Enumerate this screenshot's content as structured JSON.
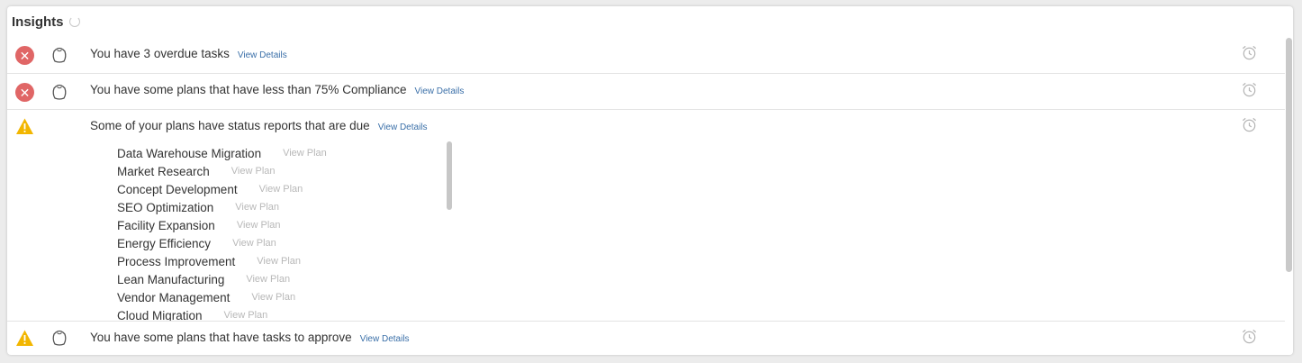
{
  "panel": {
    "title": "Insights",
    "loading_icon": "spinner-icon"
  },
  "insights": [
    {
      "status": "error",
      "status_icon": "error-circle-icon",
      "has_bag_icon": true,
      "message": "You have 3 overdue tasks",
      "link": "View Details"
    },
    {
      "status": "error",
      "status_icon": "error-circle-icon",
      "has_bag_icon": true,
      "message": "You have some plans that have less than 75% Compliance",
      "link": "View Details"
    },
    {
      "status": "warning",
      "status_icon": "warning-triangle-icon",
      "has_bag_icon": false,
      "message": "Some of your plans have status reports that are due",
      "link": "View Details",
      "plans": [
        {
          "name": "Data Warehouse Migration",
          "link": "View Plan"
        },
        {
          "name": "Market Research",
          "link": "View Plan"
        },
        {
          "name": "Concept Development",
          "link": "View Plan"
        },
        {
          "name": "SEO Optimization",
          "link": "View Plan"
        },
        {
          "name": "Facility Expansion",
          "link": "View Plan"
        },
        {
          "name": "Energy Efficiency",
          "link": "View Plan"
        },
        {
          "name": "Process Improvement",
          "link": "View Plan"
        },
        {
          "name": "Lean Manufacturing",
          "link": "View Plan"
        },
        {
          "name": "Vendor Management",
          "link": "View Plan"
        },
        {
          "name": "Cloud Migration",
          "link": "View Plan"
        }
      ]
    },
    {
      "status": "warning",
      "status_icon": "warning-triangle-icon",
      "has_bag_icon": true,
      "message": "You have some plans that have tasks to approve",
      "link": "View Details"
    }
  ],
  "colors": {
    "error": "#e06666",
    "warning": "#f2b600",
    "link": "#3a6fa8",
    "muted_link": "#b8b8b8"
  }
}
